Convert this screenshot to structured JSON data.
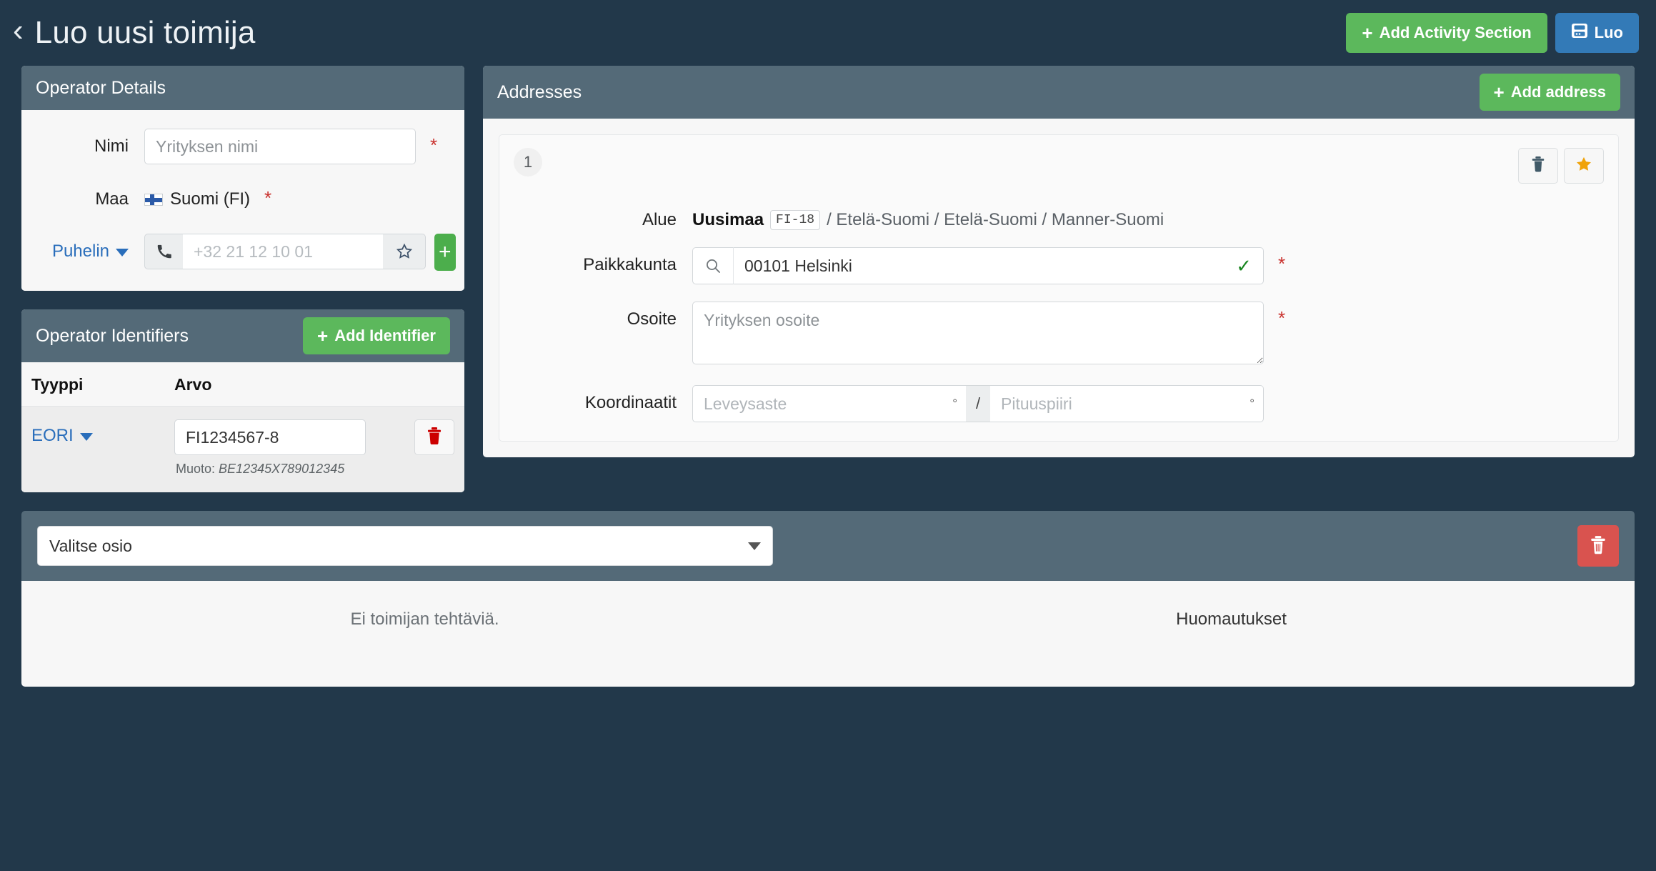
{
  "header": {
    "back_icon": "chevron-left-icon",
    "title": "Luo uusi toimija",
    "add_activity_section_label": "Add Activity Section",
    "save_label": "Luo",
    "plus_glyph": "+"
  },
  "operator_details": {
    "panel_title": "Operator Details",
    "name": {
      "label": "Nimi",
      "placeholder": "Yrityksen nimi",
      "value": "",
      "required_marker": "*"
    },
    "country": {
      "label": "Maa",
      "value": "Suomi (FI)",
      "flag": "finland-flag-icon",
      "required_marker": "*"
    },
    "phone": {
      "label": "Puhelin",
      "type_icon": "phone-icon",
      "placeholder": "+32 21 12 10 01",
      "value": "",
      "favorite_icon": "star-outline-icon",
      "add_glyph": "+"
    }
  },
  "operator_identifiers": {
    "panel_title": "Operator Identifiers",
    "add_label": "Add Identifier",
    "plus_glyph": "+",
    "columns": [
      "Tyyppi",
      "Arvo"
    ],
    "rows": [
      {
        "type": "EORI",
        "value": "FI1234567-8",
        "hint_prefix": "Muoto:",
        "hint_format": "BE12345X789012345",
        "delete_icon": "trash-icon"
      }
    ]
  },
  "addresses": {
    "panel_title": "Addresses",
    "add_label": "Add address",
    "plus_glyph": "+",
    "cards": [
      {
        "index": "1",
        "delete_icon": "trash-icon",
        "primary_icon": "star-filled-icon",
        "region": {
          "label": "Alue",
          "name": "Uusimaa",
          "code": "FI-18",
          "path": "/ Etelä-Suomi / Etelä-Suomi / Manner-Suomi"
        },
        "locality": {
          "label": "Paikkakunta",
          "search_icon": "search-icon",
          "value": "00101 Helsinki",
          "valid_icon": "check-icon",
          "required_marker": "*"
        },
        "street": {
          "label": "Osoite",
          "placeholder": "Yrityksen osoite",
          "value": "",
          "required_marker": "*"
        },
        "coordinates": {
          "label": "Koordinaatit",
          "latitude_placeholder": "Leveysaste",
          "longitude_placeholder": "Pituuspiiri",
          "latitude_value": "",
          "longitude_value": "",
          "degree_symbol": "°",
          "separator": "/"
        }
      }
    ]
  },
  "activity_section": {
    "select_value": "Valitse osio",
    "delete_icon": "trash-icon",
    "empty_roles_text": "Ei toimijan tehtäviä.",
    "notes_label": "Huomautukset"
  },
  "colors": {
    "page_background": "#22384a",
    "panel_header": "#546a78",
    "green": "#5cb85c",
    "blue": "#337ab7",
    "red": "#d9534f",
    "link": "#2a6ebb",
    "star_active": "#f0a30a",
    "required": "#c9302c",
    "valid": "#18851f"
  }
}
